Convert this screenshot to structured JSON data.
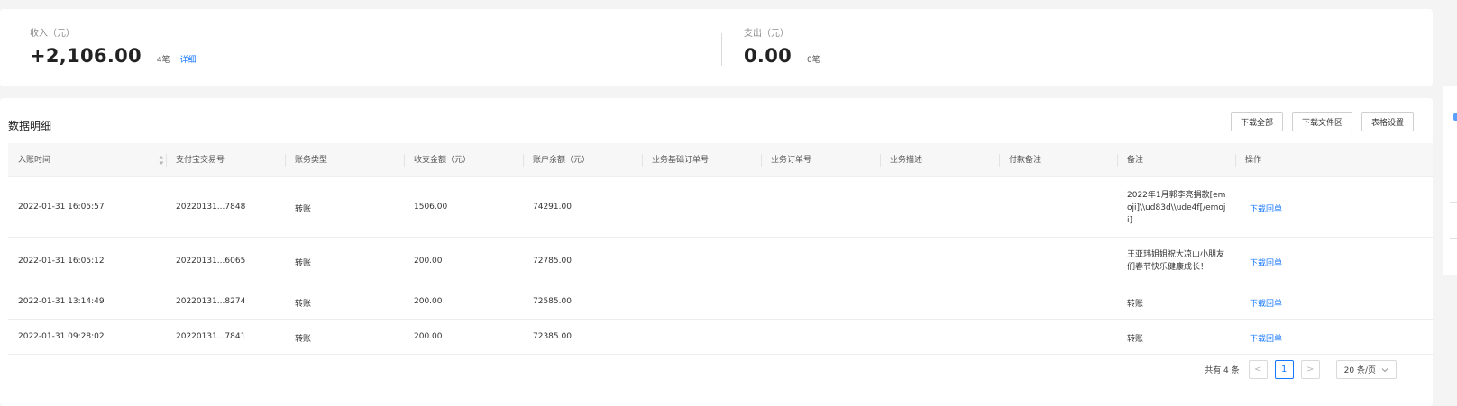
{
  "summary": {
    "income": {
      "label": "收入（元）",
      "amount": "+2,106.00",
      "count": "4笔",
      "detail_link": "详细"
    },
    "expense": {
      "label": "支出（元）",
      "amount": "0.00",
      "count": "0笔"
    }
  },
  "panel": {
    "title": "数据明细",
    "toolbar": {
      "download_all": "下载全部",
      "download_files": "下载文件区",
      "table_settings": "表格设置"
    }
  },
  "table": {
    "headers": [
      "入账时间",
      "支付宝交易号",
      "账务类型",
      "收支金额（元）",
      "账户余额（元）",
      "业务基础订单号",
      "业务订单号",
      "业务描述",
      "付款备注",
      "备注",
      "操作"
    ],
    "rows": [
      {
        "time": "2022-01-31 16:05:57",
        "trade_no": "20220131...7848",
        "type": "转账",
        "amount": "1506.00",
        "balance": "74291.00",
        "note": "2022年1月郭李亮捐款[emoji]\\\\ud83d\\\\ude4f[/emoji]",
        "action": "下载回单"
      },
      {
        "time": "2022-01-31 16:05:12",
        "trade_no": "20220131...6065",
        "type": "转账",
        "amount": "200.00",
        "balance": "72785.00",
        "note": "王亚玮姐姐祝大凉山小朋友们春节快乐健康成长！",
        "action": "下载回单"
      },
      {
        "time": "2022-01-31 13:14:49",
        "trade_no": "20220131...8274",
        "type": "转账",
        "amount": "200.00",
        "balance": "72585.00",
        "note": "转账",
        "action": "下载回单"
      },
      {
        "time": "2022-01-31 09:28:02",
        "trade_no": "20220131...7841",
        "type": "转账",
        "amount": "200.00",
        "balance": "72385.00",
        "note": "转账",
        "action": "下载回单"
      }
    ]
  },
  "pagination": {
    "total": "共有 4 条",
    "prev": "<",
    "current": "1",
    "next": ">",
    "page_size": "20 条/页",
    "page_size_icon": "chevron-down-icon"
  },
  "colors": {
    "link": "#1677ff",
    "background": "#f4f4f5",
    "header_bg": "#f7f7f8"
  }
}
